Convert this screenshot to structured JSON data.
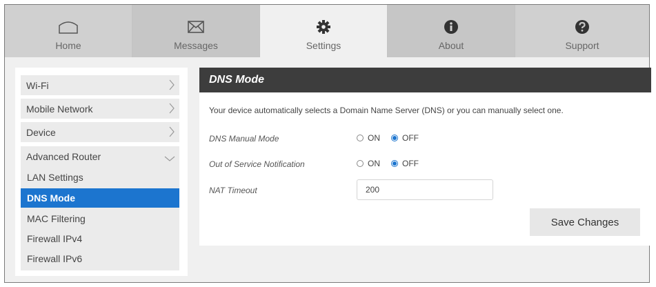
{
  "tabs": [
    {
      "label": "Home",
      "icon": "home-icon"
    },
    {
      "label": "Messages",
      "icon": "envelope-icon"
    },
    {
      "label": "Settings",
      "icon": "gear-icon",
      "active": true
    },
    {
      "label": "About",
      "icon": "info-icon"
    },
    {
      "label": "Support",
      "icon": "question-icon"
    }
  ],
  "sidebar": {
    "items": [
      {
        "label": "Wi-Fi"
      },
      {
        "label": "Mobile Network"
      },
      {
        "label": "Device"
      },
      {
        "label": "Advanced Router"
      }
    ],
    "sub_items": [
      {
        "label": "LAN Settings"
      },
      {
        "label": "DNS Mode",
        "active": true
      },
      {
        "label": "MAC Filtering"
      },
      {
        "label": "Firewall IPv4"
      },
      {
        "label": "Firewall IPv6"
      }
    ]
  },
  "panel": {
    "title": "DNS Mode",
    "description": "Your device automatically selects a Domain Name Server (DNS) or you can manually select one.",
    "dns_manual_mode": {
      "label": "DNS Manual Mode",
      "on": "ON",
      "off": "OFF",
      "selected": "OFF"
    },
    "oos_notification": {
      "label": "Out of Service Notification",
      "on": "ON",
      "off": "OFF",
      "selected": "OFF"
    },
    "nat_timeout": {
      "label": "NAT Timeout",
      "value": "200"
    },
    "save_label": "Save Changes"
  },
  "colors": {
    "accent": "#1c75cf",
    "header": "#3d3d3d"
  }
}
